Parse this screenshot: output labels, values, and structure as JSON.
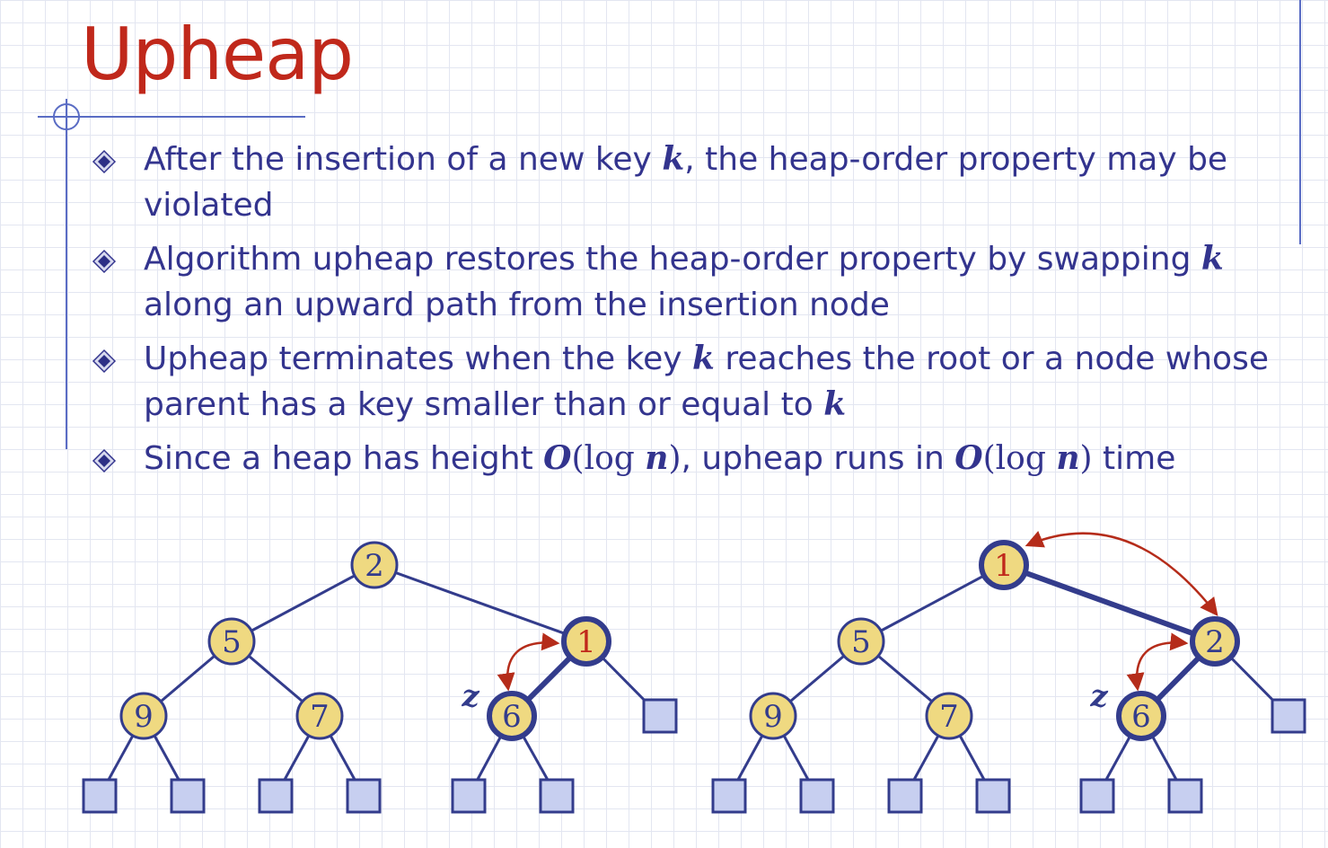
{
  "slide": {
    "title": "Upheap",
    "bullets": [
      [
        {
          "t": "After the insertion of a new key "
        },
        {
          "m": "k"
        },
        {
          "t": ", the heap-order property may be violated"
        }
      ],
      [
        {
          "t": "Algorithm upheap restores the heap-order property by swapping "
        },
        {
          "m": "k"
        },
        {
          "t": " along an upward path from the insertion node"
        }
      ],
      [
        {
          "t": "Upheap terminates when the key "
        },
        {
          "m": "k"
        },
        {
          "t": " reaches the root or a node whose parent has a key smaller than or equal to "
        },
        {
          "m": "k"
        }
      ],
      [
        {
          "t": "Since a heap has height "
        },
        {
          "m": "O"
        },
        {
          "r": "(log "
        },
        {
          "m": "n"
        },
        {
          "r": ")"
        },
        {
          "t": ", upheap runs in "
        },
        {
          "m": "O"
        },
        {
          "r": "(log "
        },
        {
          "m": "n"
        },
        {
          "r": ")"
        },
        {
          "t": " time"
        }
      ]
    ]
  },
  "colors": {
    "title": "#c0281b",
    "text": "#33348e",
    "node_fill": "#efd981",
    "node_stroke": "#333c8c",
    "leaf_fill": "#c7cff0",
    "highlight_key": "#c0281b",
    "arrow": "#b52c1a"
  },
  "icons": {
    "bullet": "diamond-bullet-icon"
  },
  "diagram": {
    "trees": [
      {
        "name": "before-upheap",
        "nodes": {
          "root": "2",
          "l": "5",
          "r": "1",
          "ll": "9",
          "lr": "7",
          "rl": "6"
        },
        "highlight_nodes": [
          "r",
          "rl"
        ],
        "highlight_keys": [
          "r"
        ],
        "swap_arrows": [
          [
            "r",
            "rl"
          ]
        ],
        "z_label": "z",
        "z_node": "rl"
      },
      {
        "name": "after-upheap",
        "nodes": {
          "root": "1",
          "l": "5",
          "r": "2",
          "ll": "9",
          "lr": "7",
          "rl": "6"
        },
        "highlight_nodes": [
          "root",
          "r",
          "rl"
        ],
        "highlight_keys": [
          "root"
        ],
        "swap_arrows": [
          [
            "root",
            "r"
          ],
          [
            "r",
            "rl"
          ]
        ],
        "z_label": "z",
        "z_node": "rl"
      }
    ]
  }
}
